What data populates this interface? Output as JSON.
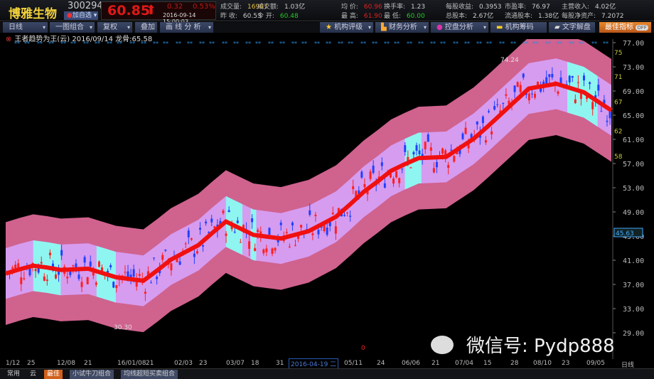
{
  "stock": {
    "name": "博雅生物",
    "code": "300294",
    "fav_label": "加自选",
    "price": "60.85",
    "change": "0.32",
    "change_pct": "0.53%",
    "time": "2016-09-14 15:00:03"
  },
  "stats": [
    {
      "k": "成交量:",
      "v": "16907",
      "c": "#e8c040"
    },
    {
      "k": "成交额:",
      "v": "1.03亿",
      "c": "#ccc"
    },
    {
      "k": "昨 收:",
      "v": "60.53",
      "c": "#ccc"
    },
    {
      "k": "今 开:",
      "v": "60.48",
      "c": "#2c2"
    },
    {
      "k": "均 价:",
      "v": "60.96",
      "c": "#e02020"
    },
    {
      "k": "换手率:",
      "v": "1.23",
      "c": "#ccc"
    },
    {
      "k": "最 高:",
      "v": "61.90",
      "c": "#e02020"
    },
    {
      "k": "最 低:",
      "v": "60.00",
      "c": "#2c2"
    },
    {
      "k": "每股收益:",
      "v": "0.3953",
      "c": "#ccc"
    },
    {
      "k": "市盈率:",
      "v": "76.97",
      "c": "#ccc"
    },
    {
      "k": "总股本:",
      "v": "2.67亿",
      "c": "#ccc"
    },
    {
      "k": "流通股本:",
      "v": "1.38亿",
      "c": "#ccc"
    },
    {
      "k": "主营收入:",
      "v": "4.02亿",
      "c": "#ccc"
    },
    {
      "k": "每股净资产:",
      "v": "7.2072",
      "c": "#ccc"
    }
  ],
  "toolbar": {
    "period": "日线",
    "combo": "一图组合",
    "adjust": "复权",
    "overlay": "叠加",
    "draw": "画 线 分 析",
    "rating": "机构评级",
    "finance": "财务分析",
    "control": "控盘分析",
    "chips": "机构筹码",
    "text": "文字解盘",
    "best": "最佳指标",
    "toggle": "OFF"
  },
  "indicator": "王者趋势为王(云) 2016/09/14 龙骨:65.58",
  "chart_data": {
    "type": "candlestick",
    "ylim": [
      29,
      77
    ],
    "yticks": [
      "77.00",
      "73.00",
      "69.00",
      "65.00",
      "61.00",
      "57.00",
      "53.00",
      "49.00",
      "45.00",
      "41.00",
      "37.00",
      "33.00",
      "29.00"
    ],
    "midline": [
      38.8,
      39.5,
      40.1,
      39.8,
      39.4,
      39.5,
      39.6,
      38.9,
      38.2,
      37.9,
      37.6,
      39.3,
      41.1,
      42.3,
      43.5,
      45.5,
      47.4,
      46.3,
      45.2,
      44.9,
      44.6,
      45.2,
      45.8,
      47.0,
      48.2,
      50.2,
      52.3,
      54.0,
      55.8,
      56.9,
      57.9,
      58.0,
      58.1,
      59.6,
      61.1,
      63.1,
      65.2,
      67.3,
      69.4,
      69.8,
      70.2,
      69.5,
      68.8,
      67.3,
      65.8
    ],
    "band_outer": 8.5,
    "band_inner": 4.2,
    "cyan_zones": [
      [
        2,
        4
      ],
      [
        6.6,
        8
      ],
      [
        16,
        17.2
      ],
      [
        17.8,
        18.2
      ],
      [
        29,
        30.2
      ],
      [
        40.8,
        43
      ]
    ],
    "annotations": {
      "high": "74.24",
      "low": "30.30",
      "last_label": "45.63",
      "marker": "0"
    },
    "right_partial": [
      "75",
      "71",
      "67",
      "62",
      "58"
    ],
    "xticks": [
      "1/12",
      "25",
      "12/08",
      "21",
      "16/01/08",
      "21",
      "02/03",
      "23",
      "03/07",
      "18",
      "31",
      "05/11",
      "24",
      "06/06",
      "21",
      "07/04",
      "15",
      "28",
      "08/10",
      "23",
      "09/05"
    ],
    "cursor_date": "2016-04-19 二",
    "period_label": "日线"
  },
  "tabs": [
    "常用",
    "云",
    "最佳",
    "小试牛刀组合",
    "均线超短买卖组合"
  ],
  "watermark": "微信号: Pydp888"
}
